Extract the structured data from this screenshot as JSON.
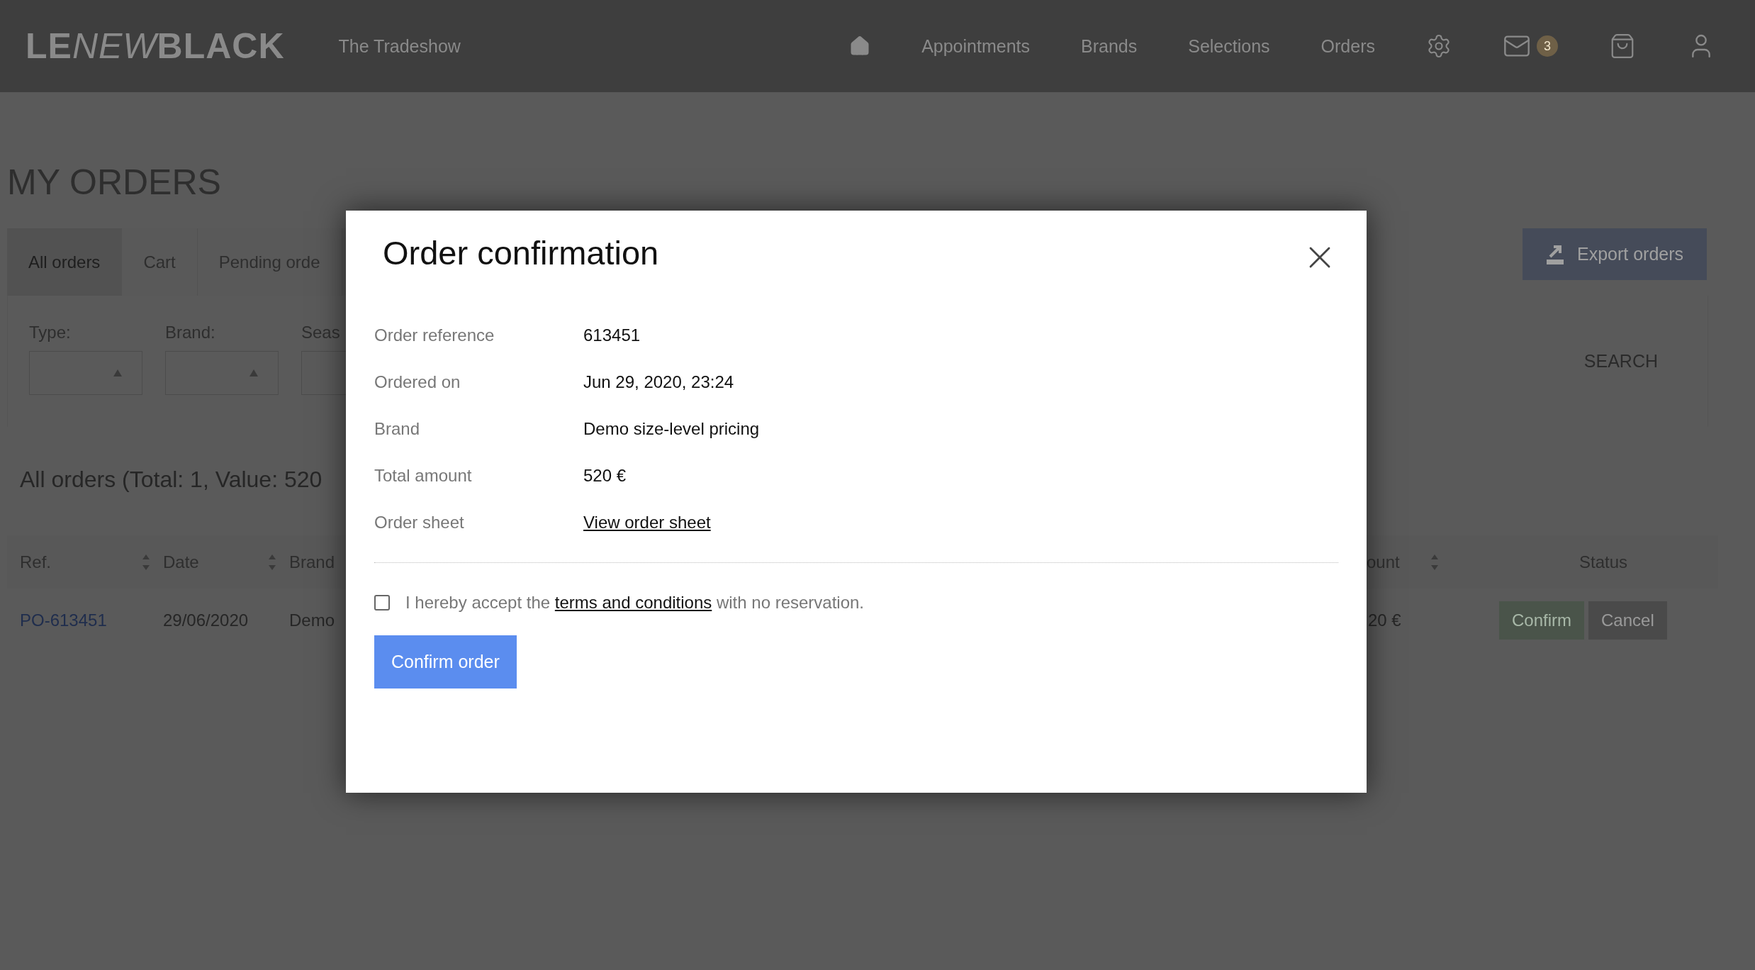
{
  "header": {
    "logo": [
      {
        "text": "LE",
        "kind": "bold"
      },
      {
        "text": "NEW",
        "kind": "italic"
      },
      {
        "text": "BLACK",
        "kind": "bold"
      }
    ],
    "event": "The Tradeshow",
    "nav": [
      "Appointments",
      "Brands",
      "Selections",
      "Orders"
    ],
    "mail_badge": "3"
  },
  "page": {
    "title": "MY ORDERS",
    "tabs": [
      {
        "label": "All orders",
        "selected": true
      },
      {
        "label": "Cart",
        "selected": false
      },
      {
        "label": "Pending orde",
        "selected": false
      }
    ],
    "export_button": "Export orders",
    "filters": [
      {
        "label": "Type:"
      },
      {
        "label": "Brand:"
      },
      {
        "label": "Seas"
      }
    ],
    "search_button": "SEARCH",
    "summary": "All orders (Total: 1, Value: 520",
    "table": {
      "columns_left": [
        {
          "label": "Ref.",
          "sortable": true
        },
        {
          "label": "Date",
          "sortable": true
        },
        {
          "label": "Brand",
          "sortable": false
        }
      ],
      "columns_right": [
        {
          "label": "ount",
          "sortable": true
        },
        {
          "label": "Status",
          "sortable": false
        }
      ],
      "row": {
        "cells_left": [
          "PO-613451",
          "29/06/2020",
          "Demo"
        ],
        "cells_right": [
          "20 €"
        ],
        "actions": [
          {
            "label": "Confirm",
            "kind": "confirm"
          },
          {
            "label": "Cancel",
            "kind": "cancel"
          }
        ]
      }
    }
  },
  "modal": {
    "title": "Order confirmation",
    "details": [
      {
        "label": "Order reference",
        "value": "613451",
        "kind": "text"
      },
      {
        "label": "Ordered on",
        "value": "Jun 29, 2020, 23:24",
        "kind": "text"
      },
      {
        "label": "Brand",
        "value": "Demo size-level pricing",
        "kind": "text"
      },
      {
        "label": "Total amount",
        "value": "520 €",
        "kind": "text"
      },
      {
        "label": "Order sheet",
        "value": "View order sheet",
        "kind": "link"
      }
    ],
    "terms": {
      "before": "I hereby accept the",
      "link": "terms and conditions",
      "after": "with no reservation.",
      "checked": false
    },
    "confirm_button": "Confirm order"
  }
}
